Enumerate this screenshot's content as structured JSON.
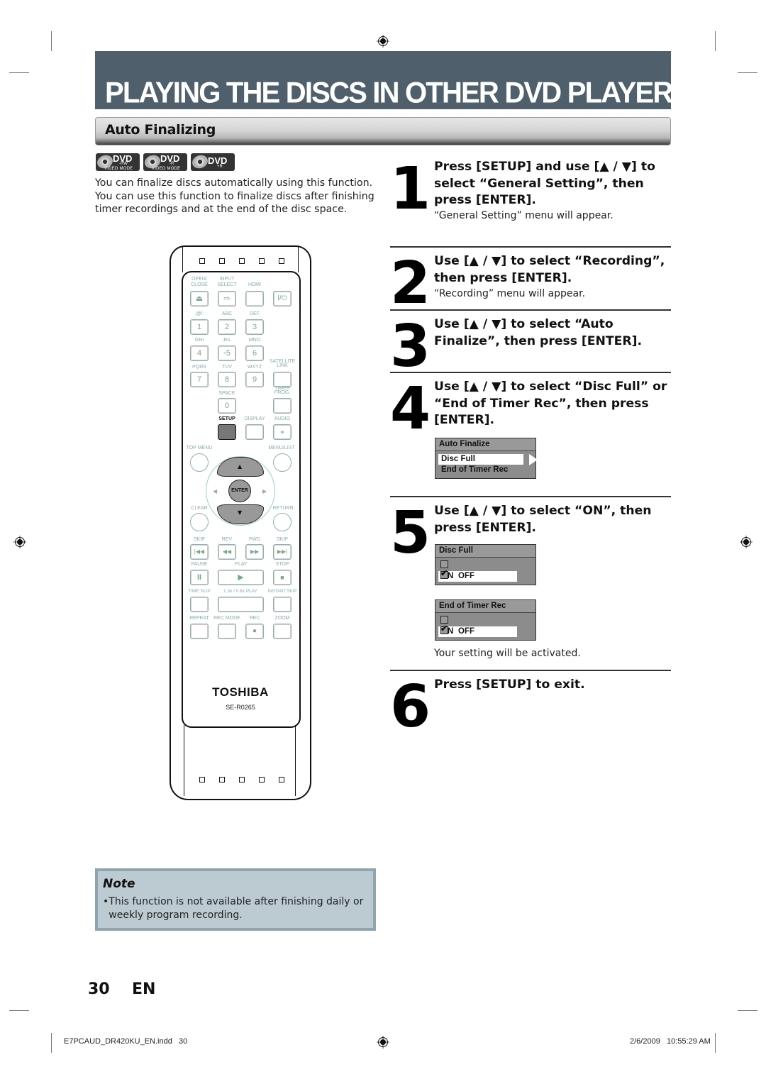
{
  "header": {
    "title": "PLAYING THE DISCS IN OTHER DVD PLAYERS",
    "section": "Auto Finalizing"
  },
  "disc_badges": [
    {
      "label": "DVD",
      "sub": "-RW",
      "mode": "VIDEO MODE"
    },
    {
      "label": "DVD",
      "sub": "-R",
      "mode": "VIDEO MODE"
    },
    {
      "label": "DVD",
      "sub": "+R",
      "mode": ""
    }
  ],
  "intro": "You can finalize discs automatically using this function. You can use this function to finalize discs after finishing timer recordings and at the end of the disc space.",
  "steps": [
    {
      "num": "1",
      "text": "Press [SETUP] and use [▲ / ▼] to select “General Setting”, then press [ENTER].",
      "sub": "“General Setting” menu will appear."
    },
    {
      "num": "2",
      "text": "Use [▲ / ▼] to select “Recording”, then press [ENTER].",
      "sub": "“Recording” menu will appear."
    },
    {
      "num": "3",
      "text": "Use [▲ / ▼] to select “Auto Finalize”, then press [ENTER].",
      "sub": ""
    },
    {
      "num": "4",
      "text": "Use [▲ / ▼] to select “Disc Full” or “End of Timer Rec”, then press [ENTER].",
      "sub": ""
    },
    {
      "num": "5",
      "text": "Use [▲ / ▼] to select “ON”, then press [ENTER].",
      "sub": "Your setting will be activated."
    },
    {
      "num": "6",
      "text": "Press [SETUP] to exit.",
      "sub": ""
    }
  ],
  "osd": {
    "auto_finalize": {
      "title": "Auto Finalize",
      "items": [
        "Disc Full",
        "End of Timer Rec"
      ],
      "selected": "Disc Full"
    },
    "disc_full": {
      "title": "Disc Full",
      "options": [
        {
          "label": "ON",
          "checked": false,
          "highlighted": true
        },
        {
          "label": "OFF",
          "checked": true,
          "highlighted": false
        }
      ]
    },
    "end_of_timer_rec": {
      "title": "End of Timer Rec",
      "options": [
        {
          "label": "ON",
          "checked": false,
          "highlighted": true
        },
        {
          "label": "OFF",
          "checked": true,
          "highlighted": false
        }
      ]
    }
  },
  "remote": {
    "brand": "TOSHIBA",
    "model": "SE-R0265",
    "labels": {
      "open_close": "OPEN/\nCLOSE",
      "input_select": "INPUT\nSELECT",
      "hdmi": "HDMI",
      "power": "I/⏻",
      "k1": "1",
      "k2": "2",
      "k3": "3",
      "k4": "4",
      "k5": "◦5",
      "k6": "6",
      "k7": "7",
      "k8": "8",
      "k9": "9",
      "k0": "0",
      "l1": ".@/:",
      "l2": "ABC",
      "l3": "DEF",
      "l4": "GHI",
      "l5": "JKL",
      "l6": "MNO",
      "l7": "PQRS",
      "l8": "TUV",
      "l9": "WXYZ",
      "satellite": "SATELLITE\nLINK",
      "space": "SPACE",
      "timer": "TIMER\nPROG.",
      "setup": "SETUP",
      "display": "DISPLAY",
      "audio": "AUDIO",
      "top_menu": "TOP MENU",
      "menu_list": "MENU/LIST",
      "enter": "ENTER",
      "clear": "CLEAR",
      "return": "RETURN",
      "skip_back": "SKIP",
      "rev": "REV",
      "fwd": "FWD",
      "skip_fwd": "SKIP",
      "pause": "PAUSE",
      "play": "PLAY",
      "stop": "STOP",
      "time_slip": "TIME SLIP",
      "speed_play": "1.3x / 0.8x PLAY",
      "instant_skip": "INSTANT SKIP",
      "repeat": "REPEAT",
      "rec_mode": "REC MODE",
      "rec": "REC",
      "zoom": "ZOOM"
    }
  },
  "note": {
    "title": "Note",
    "text": "This function is not available after finishing daily or weekly program recording."
  },
  "footer": {
    "page": "30",
    "lang": "EN",
    "file": "E7PCAUD_DR420KU_EN.indd   30",
    "timestamp": "2/6/2009   10:55:29 AM"
  }
}
